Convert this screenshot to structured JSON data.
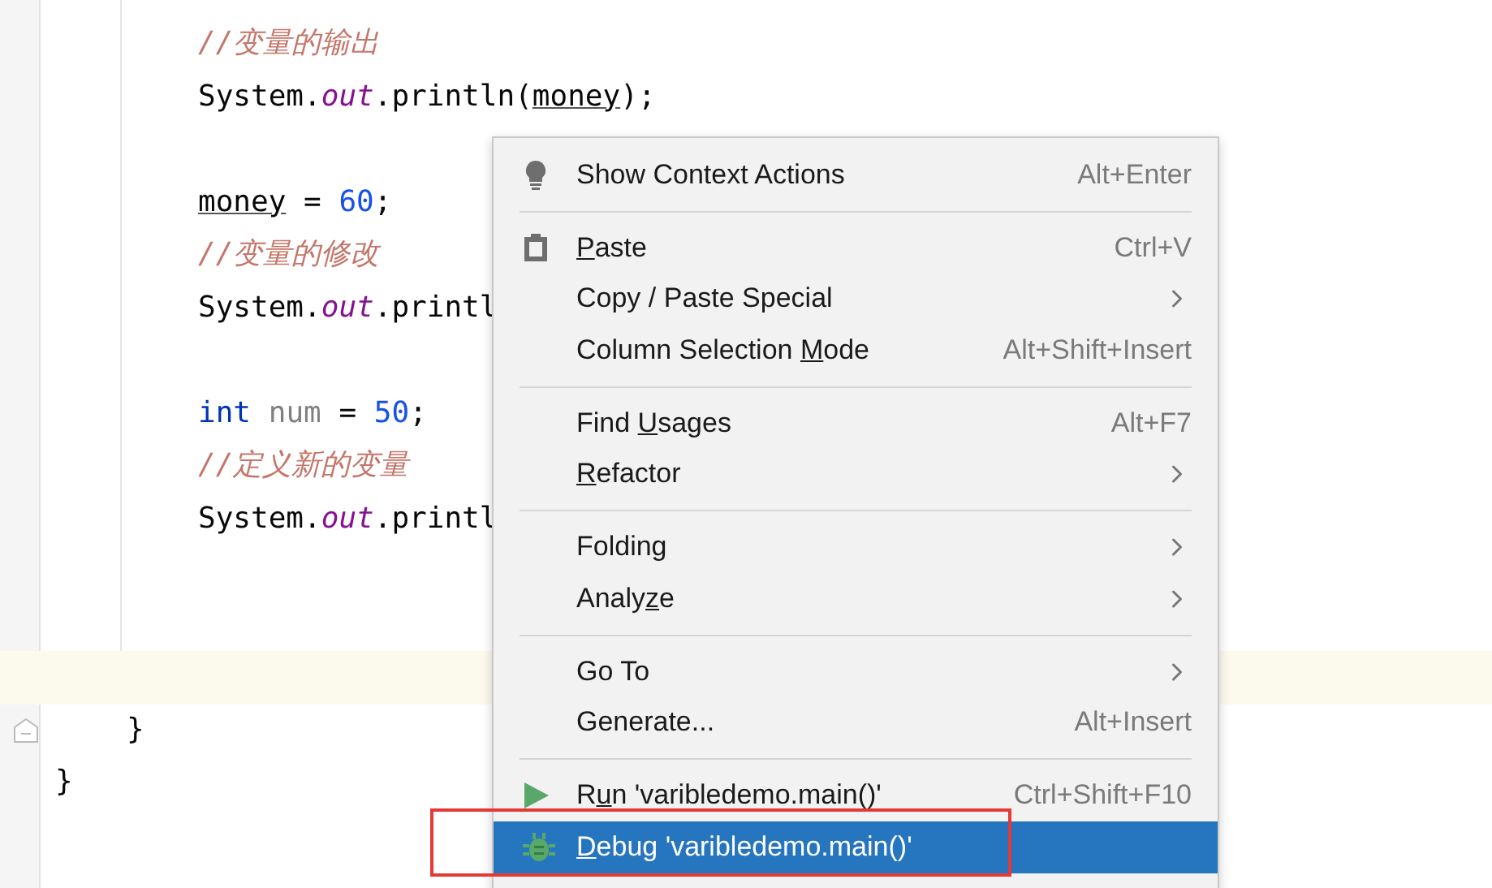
{
  "editor": {
    "lines": [
      {
        "current": false,
        "kind": "statement",
        "tokens": [
          {
            "kind": "comment",
            "text": "//变量的输出"
          }
        ]
      },
      {
        "current": false,
        "kind": "statement",
        "tokens": [
          {
            "kind": "plain",
            "text": "System."
          },
          {
            "kind": "field",
            "text": "out"
          },
          {
            "kind": "plain",
            "text": ".println("
          },
          {
            "kind": "variable",
            "text": "money"
          },
          {
            "kind": "plain",
            "text": ");"
          }
        ]
      },
      {
        "current": false
      },
      {
        "current": false,
        "kind": "statement",
        "tokens": [
          {
            "kind": "variable",
            "text": "money"
          },
          {
            "kind": "plain",
            "text": " = "
          },
          {
            "kind": "number",
            "text": "60"
          },
          {
            "kind": "plain",
            "text": ";"
          }
        ]
      },
      {
        "current": false,
        "kind": "statement",
        "tokens": [
          {
            "kind": "comment",
            "text": "//变量的修改"
          }
        ]
      },
      {
        "current": false,
        "kind": "statement",
        "tokens": [
          {
            "kind": "plain",
            "text": "System."
          },
          {
            "kind": "field",
            "text": "out"
          },
          {
            "kind": "plain",
            "text": ".printl"
          }
        ]
      },
      {
        "current": false
      },
      {
        "current": false,
        "kind": "statement",
        "tokens": [
          {
            "kind": "keyword",
            "text": "int "
          },
          {
            "kind": "unused",
            "text": "num"
          },
          {
            "kind": "plain",
            "text": " = "
          },
          {
            "kind": "number",
            "text": "50"
          },
          {
            "kind": "plain",
            "text": ";"
          }
        ]
      },
      {
        "current": false,
        "kind": "statement",
        "tokens": [
          {
            "kind": "comment",
            "text": "//定义新的变量"
          }
        ]
      },
      {
        "current": false,
        "kind": "statement",
        "tokens": [
          {
            "kind": "plain",
            "text": "System."
          },
          {
            "kind": "field",
            "text": "out"
          },
          {
            "kind": "plain",
            "text": ".printl"
          }
        ]
      },
      {
        "current": false
      },
      {
        "current": false
      },
      {
        "current": true
      },
      {
        "current": false,
        "fold": true,
        "kind": "method_end",
        "tokens": [
          {
            "kind": "plain",
            "text": "}"
          }
        ]
      },
      {
        "current": false,
        "kind": "class_end",
        "tokens": [
          {
            "kind": "plain",
            "text": "}"
          }
        ]
      }
    ]
  },
  "context_menu": {
    "items": [
      {
        "kind": "hint",
        "label": "Show Context Actions",
        "shortcut": "Alt+Enter",
        "submenu": false,
        "selected": false
      },
      {
        "kind": "separator"
      },
      {
        "kind": "paste",
        "mnemonic": "P",
        "after": "aste",
        "shortcut": "Ctrl+V",
        "submenu": false,
        "selected": false
      },
      {
        "kind": "action",
        "label": "Copy / Paste Special",
        "submenu": true,
        "selected": false
      },
      {
        "kind": "action",
        "before": "Column Selection ",
        "mnemonic": "M",
        "after": "ode",
        "shortcut": "Alt+Shift+Insert",
        "submenu": false,
        "selected": false
      },
      {
        "kind": "separator"
      },
      {
        "kind": "action",
        "before": "Find ",
        "mnemonic": "U",
        "after": "sages",
        "shortcut": "Alt+F7",
        "submenu": false,
        "selected": false
      },
      {
        "kind": "action",
        "mnemonic": "R",
        "after": "efactor",
        "submenu": true,
        "selected": false
      },
      {
        "kind": "separator"
      },
      {
        "kind": "action",
        "label": "Folding",
        "submenu": true,
        "selected": false
      },
      {
        "kind": "action",
        "before": "Analy",
        "mnemonic": "z",
        "after": "e",
        "submenu": true,
        "selected": false
      },
      {
        "kind": "separator"
      },
      {
        "kind": "action",
        "label": "Go To",
        "submenu": true,
        "selected": false
      },
      {
        "kind": "action",
        "label": "Generate...",
        "shortcut": "Alt+Insert",
        "submenu": false,
        "selected": false
      },
      {
        "kind": "separator"
      },
      {
        "kind": "run",
        "before": "R",
        "mnemonic": "u",
        "after": "n 'varibledemo.main()'",
        "shortcut": "Ctrl+Shift+F10",
        "submenu": false,
        "selected": false
      },
      {
        "kind": "debug",
        "mnemonic": "D",
        "after": "ebug 'varibledemo.main()'",
        "submenu": false,
        "selected": true
      }
    ]
  },
  "annotation": {
    "kind": "rectangle"
  }
}
